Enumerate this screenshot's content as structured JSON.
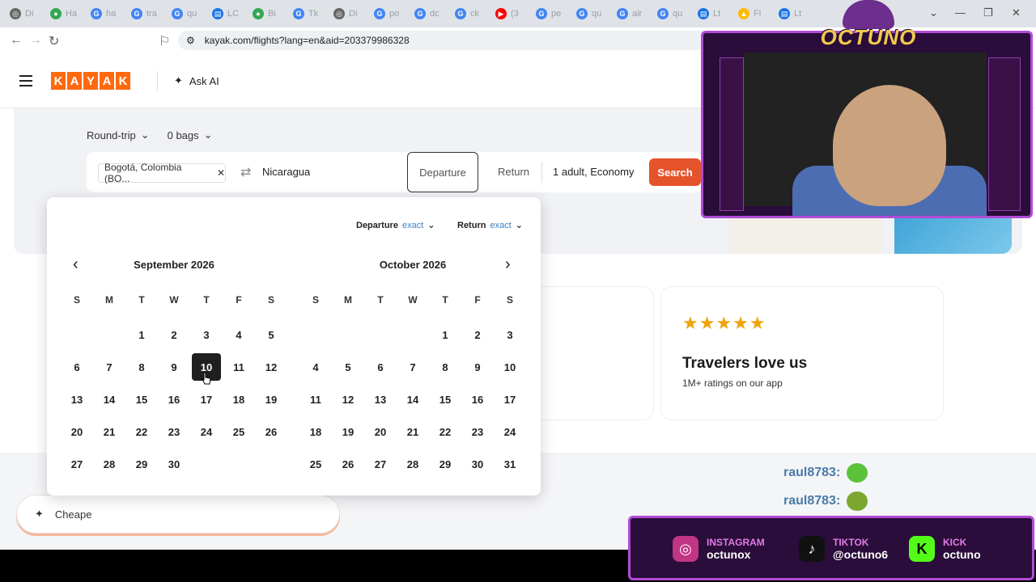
{
  "browser": {
    "tabs": [
      {
        "icon": "globe-icon",
        "text": "Di"
      },
      {
        "icon": "maps-pin-icon",
        "text": "Ha"
      },
      {
        "icon": "google-icon",
        "text": "ha"
      },
      {
        "icon": "google-icon",
        "text": "tra"
      },
      {
        "icon": "google-icon",
        "text": "qu"
      },
      {
        "icon": "document-icon",
        "text": "LC"
      },
      {
        "icon": "maps-pin-icon",
        "text": "Bi"
      },
      {
        "icon": "google-icon",
        "text": "Tk"
      },
      {
        "icon": "globe-icon",
        "text": "Di"
      },
      {
        "icon": "google-icon",
        "text": "po"
      },
      {
        "icon": "google-icon",
        "text": "dc"
      },
      {
        "icon": "google-icon",
        "text": "ck"
      },
      {
        "icon": "youtube-icon",
        "text": "(3"
      },
      {
        "icon": "google-icon",
        "text": "pe"
      },
      {
        "icon": "google-icon",
        "text": "qu"
      },
      {
        "icon": "google-icon",
        "text": "air"
      },
      {
        "icon": "google-icon",
        "text": "qu"
      },
      {
        "icon": "document-icon",
        "text": "Lt"
      },
      {
        "icon": "drive-icon",
        "text": "Fl"
      },
      {
        "icon": "document-icon",
        "text": "Lt"
      }
    ],
    "url": "kayak.com/flights?lang=en&aid=203379986328"
  },
  "header": {
    "logo_letters": [
      "K",
      "A",
      "Y",
      "A",
      "K"
    ],
    "ask_ai": "Ask AI"
  },
  "search": {
    "trip_type": "Round-trip",
    "bags": "0 bags",
    "origin": "Bogotá, Colombia (BO...",
    "destination": "Nicaragua",
    "departure_label": "Departure",
    "return_label": "Return",
    "passengers": "1 adult, Economy",
    "search_button": "Search"
  },
  "calendar": {
    "departure_mode_label": "Departure",
    "departure_mode_value": "exact",
    "return_mode_label": "Return",
    "return_mode_value": "exact",
    "weekdays": [
      "S",
      "M",
      "T",
      "W",
      "T",
      "F",
      "S"
    ],
    "months": [
      {
        "name": "September 2026",
        "first_weekday": 2,
        "days": 30
      },
      {
        "name": "October 2026",
        "first_weekday": 4,
        "days": 31
      }
    ],
    "selected": {
      "month": 0,
      "day": 10
    }
  },
  "card": {
    "stars": "★★★★★",
    "title": "Travelers love us",
    "subtitle": "1M+ ratings on our app"
  },
  "assistant": {
    "input_text": "Cheape"
  },
  "stream": {
    "brand": "OCTUNO",
    "chat": [
      {
        "user": "raul8783:"
      },
      {
        "user": "raul8783:"
      }
    ],
    "socials": [
      {
        "platform": "INSTAGRAM",
        "handle": "octunox",
        "color": "#c13584"
      },
      {
        "platform": "TIKTOK",
        "handle": "@octuno6",
        "color": "#111111"
      },
      {
        "platform": "KICK",
        "handle": "octuno",
        "color": "#53fc18"
      }
    ]
  }
}
